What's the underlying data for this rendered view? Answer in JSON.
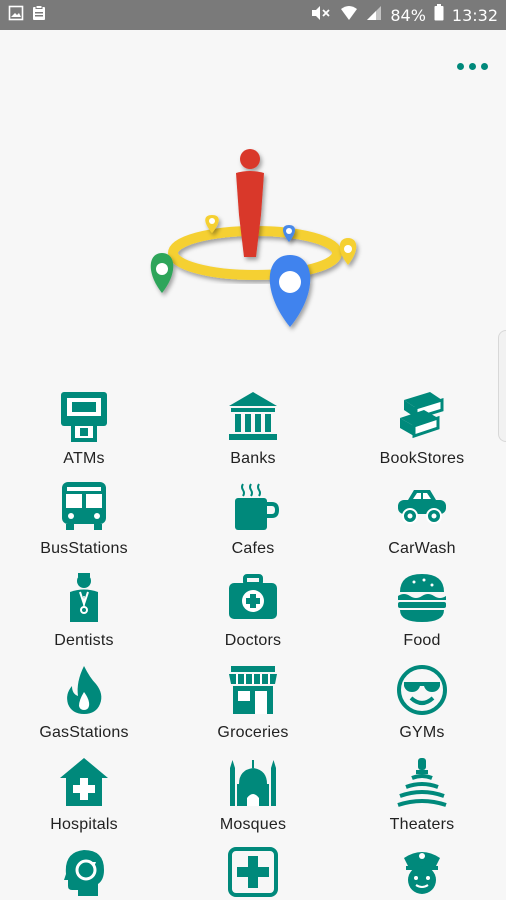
{
  "status_bar": {
    "battery": "84%",
    "time": "13:32"
  },
  "colors": {
    "accent": "#00897b",
    "status_bar": "#7a7a7a",
    "background": "#f7f7f7"
  },
  "menu": {
    "icon": "more-dots-icon"
  },
  "logo": {
    "icon": "nearby-places-logo"
  },
  "categories": [
    {
      "label": "ATMs",
      "icon": "atm-icon"
    },
    {
      "label": "Banks",
      "icon": "bank-icon"
    },
    {
      "label": "BookStores",
      "icon": "books-icon"
    },
    {
      "label": "BusStations",
      "icon": "bus-icon"
    },
    {
      "label": "Cafes",
      "icon": "coffee-cup-icon"
    },
    {
      "label": "CarWash",
      "icon": "car-icon"
    },
    {
      "label": "Dentists",
      "icon": "doctor-person-icon"
    },
    {
      "label": "Doctors",
      "icon": "medical-kit-icon"
    },
    {
      "label": "Food",
      "icon": "burger-icon"
    },
    {
      "label": "GasStations",
      "icon": "flame-icon"
    },
    {
      "label": "Groceries",
      "icon": "store-icon"
    },
    {
      "label": "GYMs",
      "icon": "cool-face-icon"
    },
    {
      "label": "Hospitals",
      "icon": "hospital-icon"
    },
    {
      "label": "Mosques",
      "icon": "mosque-icon"
    },
    {
      "label": "Theaters",
      "icon": "theater-icon"
    },
    {
      "label": "",
      "icon": "mind-refresh-icon"
    },
    {
      "label": "",
      "icon": "pharmacy-cross-icon"
    },
    {
      "label": "",
      "icon": "police-icon"
    }
  ]
}
